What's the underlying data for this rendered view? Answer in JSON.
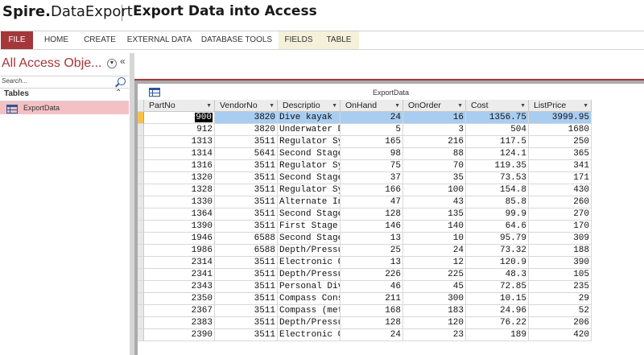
{
  "banner": {
    "brand_prefix": "Spire.",
    "brand_suffix": "DataExport",
    "title": "Export Data into Access"
  },
  "ribbon": {
    "tabs": [
      "FILE",
      "HOME",
      "CREATE",
      "EXTERNAL DATA",
      "DATABASE TOOLS",
      "FIELDS",
      "TABLE"
    ],
    "accent_color": "#a4373a",
    "contextual_color": "#f5f0d9"
  },
  "nav": {
    "title": "All Access Obje...",
    "search_placeholder": "Search...",
    "group_label": "Tables",
    "items": [
      {
        "label": "ExportData",
        "icon": "table-icon"
      }
    ]
  },
  "datasheet": {
    "title": "ExportData",
    "columns": [
      "PartNo",
      "VendorNo",
      "Descriptio",
      "OnHand",
      "OnOrder",
      "Cost",
      "ListPrice"
    ],
    "rows": [
      [
        "900",
        "3820",
        "Dive kayak",
        "24",
        "16",
        "1356.75",
        "3999.95"
      ],
      [
        "912",
        "3820",
        "Underwater D",
        "5",
        "3",
        "504",
        "1680"
      ],
      [
        "1313",
        "3511",
        "Regulator Sy",
        "165",
        "216",
        "117.5",
        "250"
      ],
      [
        "1314",
        "5641",
        "Second Stage",
        "98",
        "88",
        "124.1",
        "365"
      ],
      [
        "1316",
        "3511",
        "Regulator Sy",
        "75",
        "70",
        "119.35",
        "341"
      ],
      [
        "1320",
        "3511",
        "Second Stage",
        "37",
        "35",
        "73.53",
        "171"
      ],
      [
        "1328",
        "3511",
        "Regulator Sy",
        "166",
        "100",
        "154.8",
        "430"
      ],
      [
        "1330",
        "3511",
        "Alternate In",
        "47",
        "43",
        "85.8",
        "260"
      ],
      [
        "1364",
        "3511",
        "Second Stage",
        "128",
        "135",
        "99.9",
        "270"
      ],
      [
        "1390",
        "3511",
        "First Stage",
        "146",
        "140",
        "64.6",
        "170"
      ],
      [
        "1946",
        "6588",
        "Second Stage",
        "13",
        "10",
        "95.79",
        "309"
      ],
      [
        "1986",
        "6588",
        "Depth/Pressu",
        "25",
        "24",
        "73.32",
        "188"
      ],
      [
        "2314",
        "3511",
        "Electronic C",
        "13",
        "12",
        "120.9",
        "390"
      ],
      [
        "2341",
        "3511",
        "Depth/Pressu",
        "226",
        "225",
        "48.3",
        "105"
      ],
      [
        "2343",
        "3511",
        "Personal Div",
        "46",
        "45",
        "72.85",
        "235"
      ],
      [
        "2350",
        "3511",
        "Compass Cons",
        "211",
        "300",
        "10.15",
        "29"
      ],
      [
        "2367",
        "3511",
        "Compass (met",
        "168",
        "183",
        "24.96",
        "52"
      ],
      [
        "2383",
        "3511",
        "Depth/Pressu",
        "128",
        "120",
        "76.22",
        "206"
      ],
      [
        "2390",
        "3511",
        "Electronic C",
        "24",
        "23",
        "189",
        "420"
      ]
    ],
    "active_row": 0,
    "row_color": "#a9cdf1"
  }
}
